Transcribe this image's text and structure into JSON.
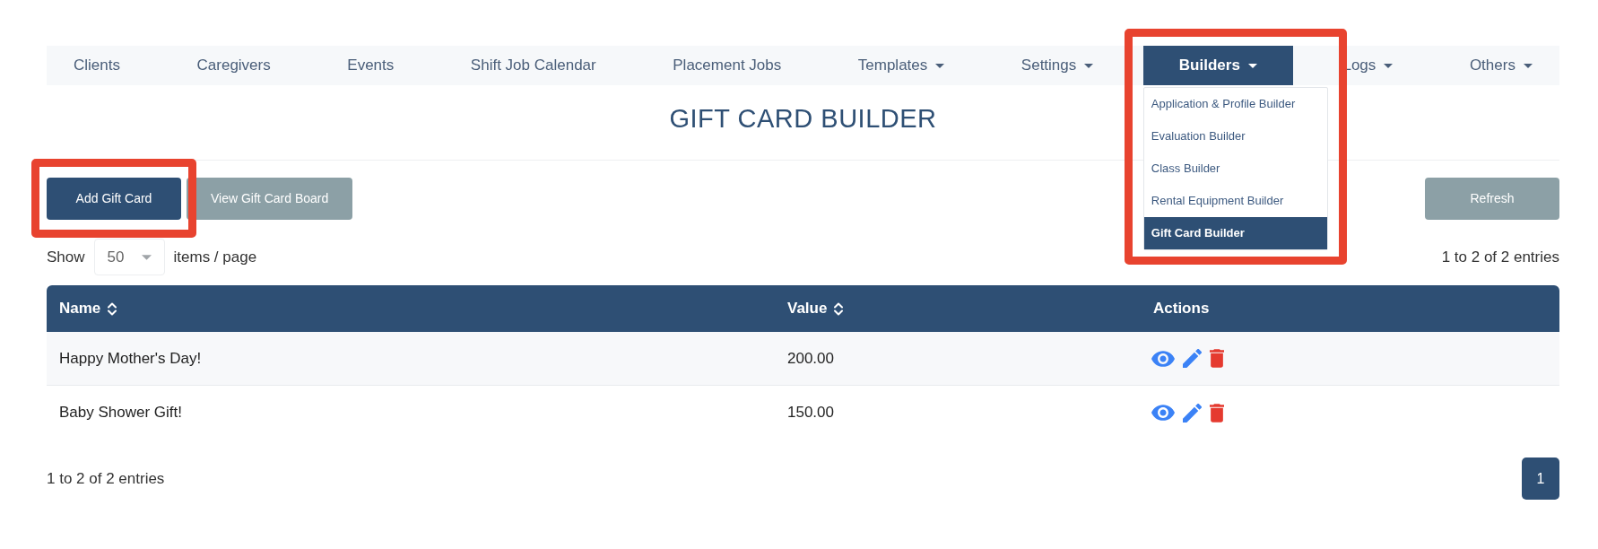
{
  "nav": {
    "items": [
      {
        "label": "Clients",
        "dropdown": false,
        "selected": false
      },
      {
        "label": "Caregivers",
        "dropdown": false,
        "selected": false
      },
      {
        "label": "Events",
        "dropdown": false,
        "selected": false
      },
      {
        "label": "Shift Job Calendar",
        "dropdown": false,
        "selected": false
      },
      {
        "label": "Placement Jobs",
        "dropdown": false,
        "selected": false
      },
      {
        "label": "Templates",
        "dropdown": true,
        "selected": false
      },
      {
        "label": "Settings",
        "dropdown": true,
        "selected": false
      },
      {
        "label": "Builders",
        "dropdown": true,
        "selected": true,
        "annotation": {
          "kind": "frame"
        },
        "menu": [
          {
            "label": "Application & Profile Builder",
            "selected": false
          },
          {
            "label": "Evaluation Builder",
            "selected": false
          },
          {
            "label": "Class Builder",
            "selected": false
          },
          {
            "label": "Rental Equipment Builder",
            "selected": false
          },
          {
            "label": "Gift Card Builder",
            "selected": true
          }
        ]
      },
      {
        "label": "Logs",
        "dropdown": true,
        "selected": false
      },
      {
        "label": "Others",
        "dropdown": true,
        "selected": false
      }
    ]
  },
  "title": "GIFT CARD BUILDER",
  "toolbar": {
    "left_buttons": [
      {
        "label": "Add Gift Card",
        "kind": "primary",
        "annotation": {
          "kind": "frame"
        }
      },
      {
        "label": "View Gift Card Board",
        "kind": "secondary"
      }
    ],
    "right_buttons": [
      {
        "label": "Refresh",
        "kind": "secondary"
      }
    ]
  },
  "page_size": {
    "label_before": "Show",
    "value": "50",
    "label_after": "items / page"
  },
  "entries_top": "1 to 2 of 2 entries",
  "table": {
    "columns": [
      {
        "label": "Name",
        "sortable": true
      },
      {
        "label": "Value",
        "sortable": true
      },
      {
        "label": "Actions",
        "sortable": false
      }
    ],
    "rows": [
      {
        "name": "Happy Mother's Day!",
        "value": "200.00"
      },
      {
        "name": "Baby Shower Gift!",
        "value": "150.00"
      }
    ]
  },
  "entries_bottom": "1 to 2 of 2 entries",
  "pagination": {
    "pages": [
      {
        "label": "1",
        "selected": true
      }
    ]
  }
}
